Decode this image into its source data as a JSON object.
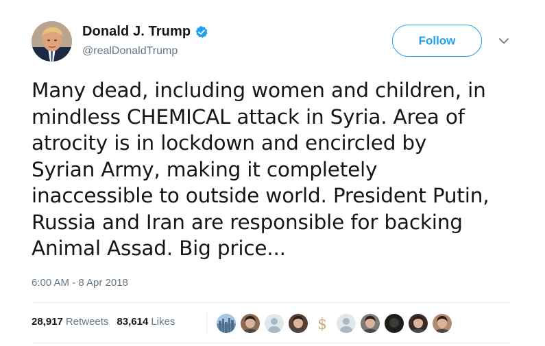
{
  "author": {
    "display_name": "Donald J. Trump",
    "handle": "@realDonaldTrump",
    "verified": true,
    "avatar_icon": "profile-photo"
  },
  "follow_button": {
    "label": "Follow"
  },
  "menu": {
    "icon": "chevron-down-icon"
  },
  "tweet": {
    "text": "Many dead, including women and children, in\nmindless CHEMICAL attack in Syria. Area of\natrocity is in lockdown and encircled by\nSyrian Army, making it completely\ninaccessible to outside world. President Putin,\nRussia and Iran are responsible for backing\nAnimal Assad. Big price...",
    "timestamp": "6:00 AM - 8 Apr 2018"
  },
  "stats": {
    "retweets_count": "28,917",
    "retweets_label": "Retweets",
    "likes_count": "83,614",
    "likes_label": "Likes"
  },
  "likers": [
    {
      "icon": "city-skyline-avatar",
      "color": "#6b8db5"
    },
    {
      "icon": "person-photo-avatar",
      "color": "#8a6a52"
    },
    {
      "icon": "default-user-avatar",
      "color": "#aab8c2"
    },
    {
      "icon": "person-photo-avatar",
      "color": "#5a4032"
    },
    {
      "icon": "dollar-sign-avatar",
      "color": "#c8b07a"
    },
    {
      "icon": "default-user-avatar",
      "color": "#aab8c2"
    },
    {
      "icon": "person-photo-avatar",
      "color": "#7d7a74"
    },
    {
      "icon": "dark-photo-avatar",
      "color": "#1f1d1b"
    },
    {
      "icon": "person-photo-avatar",
      "color": "#3a2c26"
    },
    {
      "icon": "person-photo-avatar",
      "color": "#b48a70"
    }
  ],
  "colors": {
    "accent": "#1da1f2",
    "text_primary": "#14171a",
    "text_secondary": "#657786",
    "divider": "#e6ecf0"
  }
}
